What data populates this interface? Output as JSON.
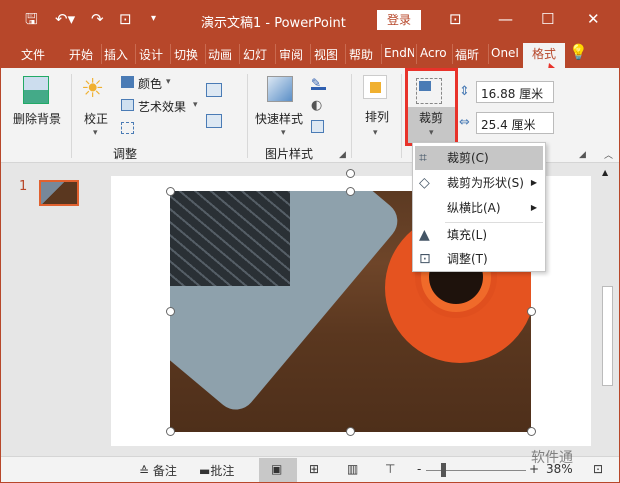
{
  "title_bar": {
    "title": "演示文稿1  -  PowerPoint",
    "login": "登录",
    "icons": [
      "save-icon",
      "undo-icon",
      "redo-icon",
      "present-from-start-icon",
      "customize-qat-icon",
      "ribbon-display-icon",
      "minimize-icon",
      "maximize-icon",
      "close-icon"
    ]
  },
  "tabs": [
    "文件",
    "开始",
    "插入",
    "设计",
    "切换",
    "动画",
    "幻灯",
    "审阅",
    "视图",
    "帮助",
    "EndN",
    "Acro",
    "福昕",
    "OneI",
    "格式"
  ],
  "active_tab": "格式",
  "ribbon": {
    "remove_bg": "删除背景",
    "corrections": "校正",
    "color": "颜色",
    "artistic": "艺术效果",
    "group_adjust": "调整",
    "quick_styles": "快速样式",
    "group_picture_styles": "图片样式",
    "arrange": "排列",
    "crop": "裁剪",
    "height": "16.88 厘米",
    "width": "25.4 厘米"
  },
  "crop_menu": [
    {
      "label": "裁剪(C)",
      "icon": "crop-icon",
      "submenu": false
    },
    {
      "label": "裁剪为形状(S)",
      "icon": "crop-to-shape-icon",
      "submenu": true
    },
    {
      "label": "纵横比(A)",
      "icon": "",
      "submenu": true
    },
    {
      "label": "填充(L)",
      "icon": "fill-icon",
      "submenu": false
    },
    {
      "label": "调整(T)",
      "icon": "fit-icon",
      "submenu": false
    }
  ],
  "slides": {
    "number": "1"
  },
  "status": {
    "notes": "备注",
    "comments": "批注",
    "zoom": "38%",
    "watermark": "软件通"
  },
  "colors": {
    "accent": "#b7472a",
    "highlight": "#e8322a"
  }
}
